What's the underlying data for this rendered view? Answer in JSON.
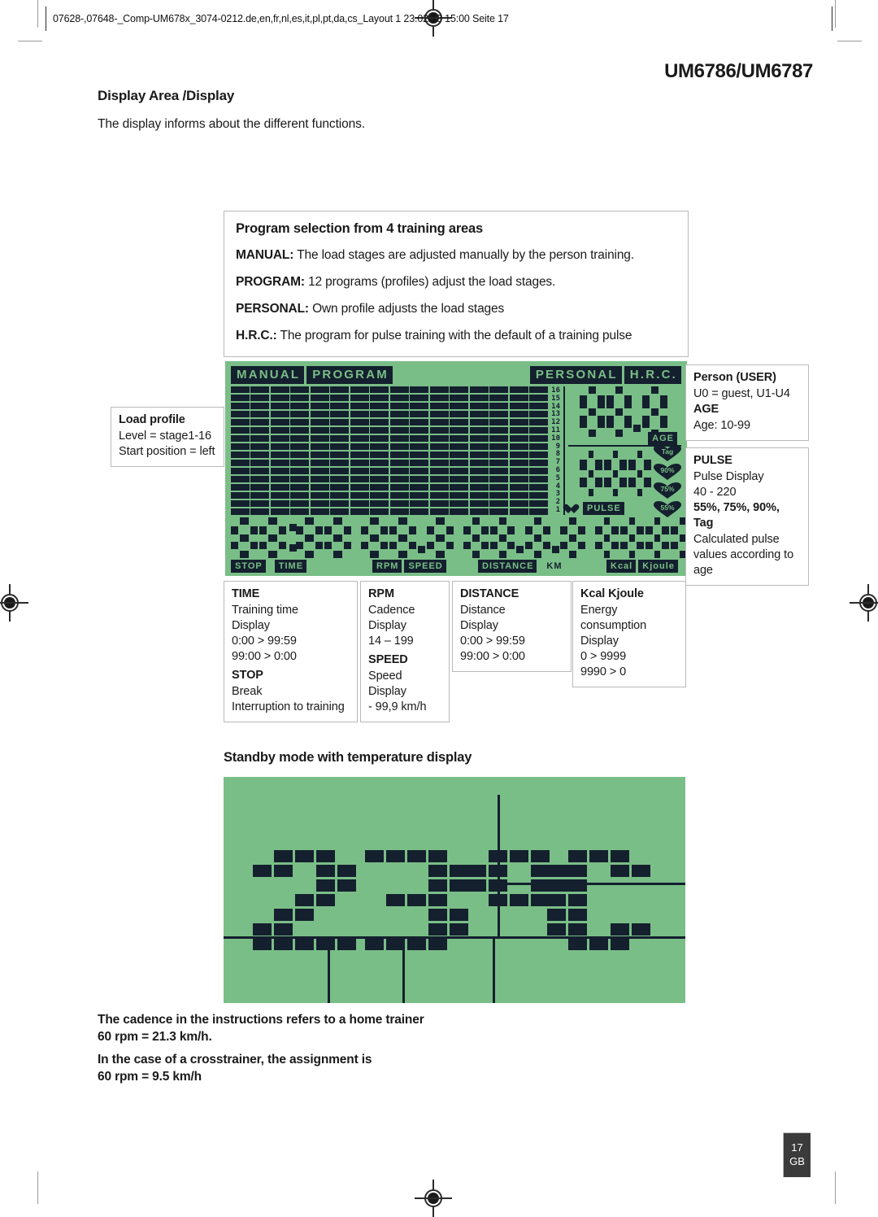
{
  "sheet": {
    "header_text": "07628-,07648-_Comp-UM678x_3074-0212.de,en,fr,nl,es,it,pl,pt,da,cs_Layout 1  23.02.13  15:00  Seite 17",
    "model_title": "UM6786/UM6787",
    "page_number": "17",
    "page_lang": "GB"
  },
  "section": {
    "heading": "Display Area /Display",
    "intro": "The display informs about the different functions."
  },
  "program_box": {
    "title": "Program selection from 4 training areas",
    "items": [
      {
        "term": "MANUAL:",
        "desc": " The load stages are adjusted manually by the person training."
      },
      {
        "term": "PROGRAM:",
        "desc": " 12 programs (profiles) adjust the load stages."
      },
      {
        "term": "PERSONAL:",
        "desc": " Own profile adjusts the load stages"
      },
      {
        "term": "H.R.C.:",
        "desc": " The program for pulse training with the default of a training pulse"
      }
    ]
  },
  "lcd": {
    "mode_labels": [
      "MANUAL",
      "PROGRAM",
      "PERSONAL",
      "H.R.C."
    ],
    "scale_values": [
      "16",
      "15",
      "14",
      "13",
      "12",
      "11",
      "10",
      "9",
      "8",
      "7",
      "6",
      "5",
      "4",
      "3",
      "2",
      "1"
    ],
    "age_label": "AGE",
    "pulse_label": "PULSE",
    "zone_labels": [
      "Tag",
      "90%",
      "75%",
      "55%"
    ],
    "age_digits": "88.8",
    "pulse_digits": "888",
    "time_digits": "88:88",
    "rpm_digits": "88.8",
    "distance_digits": "88.8.8",
    "kcal_digits": "8888",
    "bottom_labels": {
      "stop": "STOP",
      "time": "TIME",
      "rpm": "RPM",
      "speed": "SPEED",
      "distance": "DISTANCE",
      "km": "KM",
      "kcal": "Kcal",
      "kjoule": "Kjoule"
    },
    "matrix_columns": 16,
    "matrix_rows": 16,
    "background_color": "#7abe87",
    "ink_color": "#14202e"
  },
  "callouts": {
    "load_profile": {
      "title": "Load profile",
      "lines": [
        "Level = stage1-16",
        "Start position = left"
      ]
    },
    "person": {
      "title": "Person (USER)",
      "lines": [
        "U0 = guest, U1-U4"
      ],
      "sub_title": "AGE",
      "sub_lines": [
        "Age: 10-99"
      ]
    },
    "pulse": {
      "title": "PULSE",
      "lines": [
        "Pulse  Display",
        "40 - 220"
      ],
      "sub_title": "55%, 75%, 90%, Tag",
      "sub_lines": [
        "Calculated pulse values according to age"
      ]
    },
    "time": {
      "title": "TIME",
      "lines": [
        "Training time",
        "Display",
        "0:00 > 99:59",
        "99:00 > 0:00"
      ],
      "sub_title": "STOP",
      "sub_lines": [
        "Break",
        "Interruption to training"
      ]
    },
    "rpm": {
      "title": "RPM",
      "lines": [
        "Cadence",
        "Display",
        "14 – 199"
      ],
      "sub_title": "SPEED",
      "sub_lines": [
        "Speed",
        "Display",
        "- 99,9 km/h"
      ]
    },
    "distance": {
      "title": "DISTANCE",
      "lines": [
        "Distance",
        "Display",
        "0:00 > 99:59",
        "99:00 > 0:00"
      ]
    },
    "kcal": {
      "title": "Kcal Kjoule",
      "lines": [
        "Energy consumption",
        "Display",
        "0 > 9999",
        "9990 > 0"
      ]
    }
  },
  "standby": {
    "heading": "Standby mode with temperature display",
    "temperature_text": "23°C"
  },
  "footnotes": {
    "note1_line1": "The cadence in the instructions refers to a home trainer",
    "note1_line2": "60 rpm = 21.3 km/h.",
    "note2_line1": "In the case of a crosstrainer, the assignment is",
    "note2_line2": "60 rpm = 9.5 km/h"
  }
}
